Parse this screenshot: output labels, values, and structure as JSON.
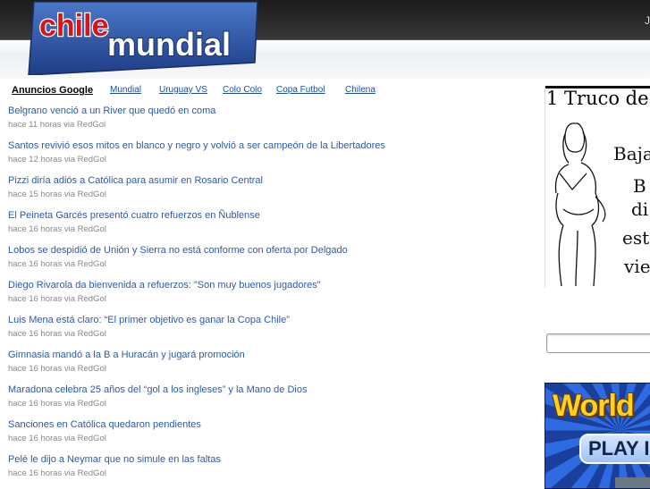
{
  "header": {
    "logo_line1": "chile",
    "logo_line2": "mundial",
    "topbar_right_text": "J"
  },
  "nav": {
    "heading": "Anuncios Google",
    "items": [
      "Mundial",
      "Uruguay VS",
      "Colo Colo",
      "Copa Futbol",
      "Chilena"
    ]
  },
  "news": [
    {
      "title": "Belgrano venció a un River que quedó en coma",
      "meta": "hace 11 horas via RedGol"
    },
    {
      "title": "Santos revivió esos mitos en blanco y negro y volvió a ser campeón de la Libertadores",
      "meta": "hace 12 horas via RedGol"
    },
    {
      "title": "Pizzi diría adiós a Católica para asumir en Rosario Central",
      "meta": "hace 15 horas via RedGol"
    },
    {
      "title": "El Peineta Garcés presentó cuatro refuerzos en Ñublense",
      "meta": "hace 16 horas via RedGol"
    },
    {
      "title": "Lobos se despidió de Unión y Sierra no está conforme con oferta por Delgado",
      "meta": "hace 16 horas via RedGol"
    },
    {
      "title": "Diego Rivarola da bienvenida a refuerzos: \"Son muy buenos jugadores\"",
      "meta": "hace 16 horas via RedGol"
    },
    {
      "title": "Luis Mena está claro: “El primer objetivo es ganar la Copa Chile”",
      "meta": "hace 16 horas via RedGol"
    },
    {
      "title": "Gimnasia mandó a la B a Huracán y jugará promoción",
      "meta": "hace 16 horas via RedGol"
    },
    {
      "title": "Maradona celebra 25 años del “gol a los ingleses” y la Mano de Dios",
      "meta": "hace 16 horas via RedGol"
    },
    {
      "title": "Sanciones en Católica quedaron pendientes",
      "meta": "hace 16 horas via RedGol"
    },
    {
      "title": "Pelé le dijo a Neymar que no simule en las faltas",
      "meta": "hace 16 horas via RedGol"
    }
  ],
  "ad1": {
    "title": "1 Truco de",
    "words": [
      "Baja",
      "B",
      "di",
      "esto",
      "vie"
    ]
  },
  "ad2": {
    "title": "World",
    "play": "PLAY I"
  },
  "colors": {
    "link": "#2d5aa6",
    "nav_link": "#1b4e9a",
    "meta": "#888888",
    "logo_red": "#c8191f",
    "logo_blue": "#1f3f86"
  }
}
